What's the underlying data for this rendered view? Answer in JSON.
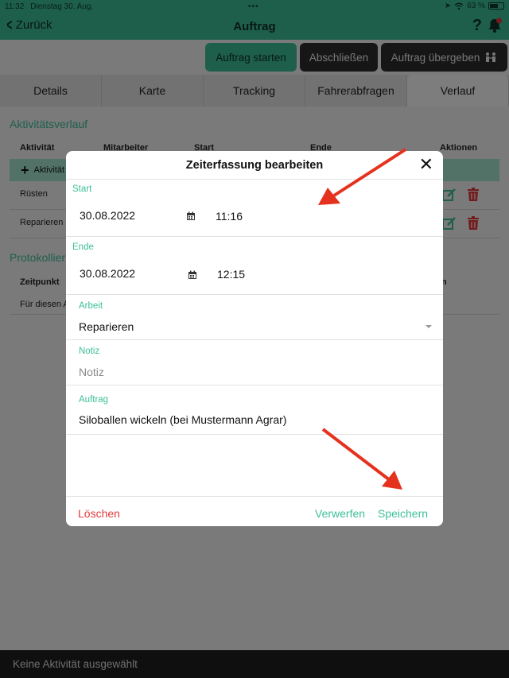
{
  "status_bar": {
    "time": "11:32",
    "date": "Dienstag 30. Aug.",
    "battery": "63 %",
    "battery_level": 0.63
  },
  "nav": {
    "back_label": "Zurück",
    "title": "Auftrag",
    "help": "?"
  },
  "actions": {
    "start": "Auftrag starten",
    "close": "Abschließen",
    "handover": "Auftrag übergeben"
  },
  "tabs": [
    {
      "label": "Details"
    },
    {
      "label": "Karte"
    },
    {
      "label": "Tracking"
    },
    {
      "label": "Fahrerabfragen"
    },
    {
      "label": "Verlauf",
      "active": true
    }
  ],
  "activity_section": {
    "title": "Aktivitätsverlauf",
    "columns": [
      "Aktivität",
      "Mitarbeiter",
      "Start",
      "Ende",
      "Aktionen"
    ],
    "add_label": "Aktivität",
    "rows": [
      {
        "activity": "Rüsten"
      },
      {
        "activity": "Reparieren"
      }
    ]
  },
  "protocol_section": {
    "title": "Protokollier",
    "columns": [
      "Zeitpunkt",
      "n"
    ],
    "rows": [
      {
        "text": "Für diesen A"
      }
    ]
  },
  "bottom_bar": {
    "text": "Keine Aktivität ausgewählt"
  },
  "modal": {
    "title": "Zeiterfassung bearbeiten",
    "close": "✕",
    "start": {
      "label": "Start",
      "date": "30.08.2022",
      "time": "11:16"
    },
    "end": {
      "label": "Ende",
      "date": "30.08.2022",
      "time": "12:15"
    },
    "work": {
      "label": "Arbeit",
      "value": "Reparieren"
    },
    "note": {
      "label": "Notiz",
      "placeholder": "Notiz"
    },
    "order": {
      "label": "Auftrag",
      "value": "Siloballen wickeln (bei Mustermann Agrar)"
    },
    "footer": {
      "delete": "Löschen",
      "discard": "Verwerfen",
      "save": "Speichern"
    }
  },
  "colors": {
    "accent": "#3cbf98",
    "danger": "#e5393a",
    "dark_button": "#2d2d2d",
    "annotation_arrow": "#e5321e"
  }
}
